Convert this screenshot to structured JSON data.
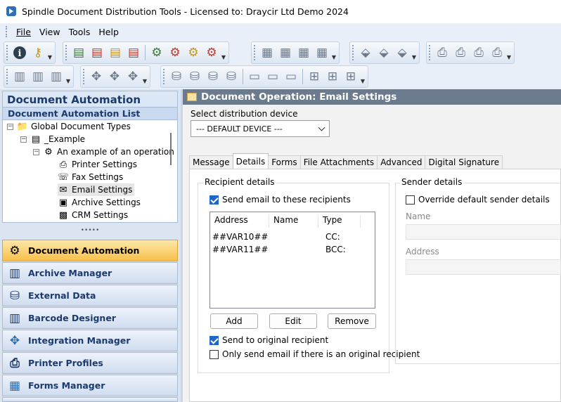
{
  "window": {
    "title": "Spindle Document Distribution Tools - Licensed to: Draycir Ltd Demo 2024"
  },
  "menu": {
    "file": "File",
    "view": "View",
    "tools": "Tools",
    "help": "Help"
  },
  "left_panel": {
    "header": "Document Automation",
    "subheader": "Document Automation List",
    "tree": {
      "root": "Global Document Types",
      "example": "_Example",
      "operation": "An example of an operation",
      "printer": "Printer Settings",
      "fax": "Fax Settings",
      "email": "Email Settings",
      "archive": "Archive Settings",
      "crm": "CRM Settings"
    },
    "splitter": "•••••",
    "nav": {
      "document_automation": "Document Automation",
      "archive_manager": "Archive Manager",
      "external_data": "External Data",
      "barcode_designer": "Barcode Designer",
      "integration_manager": "Integration Manager",
      "printer_profiles": "Printer Profiles",
      "forms_manager": "Forms Manager"
    }
  },
  "right_panel": {
    "header": "Document Operation: Email Settings",
    "device_label": "Select distribution device",
    "device_value": "--- DEFAULT DEVICE ---",
    "tabs": {
      "message": "Message",
      "details": "Details",
      "forms": "Forms",
      "file_attachments": "File Attachments",
      "advanced": "Advanced",
      "digital_signature": "Digital Signature"
    },
    "recipient": {
      "group_label": "Recipient details",
      "send_email": "Send email to these recipients",
      "col_address": "Address",
      "col_name": "Name",
      "col_type": "Type",
      "rows": [
        {
          "address": "##VAR10##",
          "name": "",
          "type": "CC:"
        },
        {
          "address": "##VAR11##",
          "name": "",
          "type": "BCC:"
        }
      ],
      "add": "Add",
      "edit": "Edit",
      "remove": "Remove",
      "send_original": "Send to original recipient",
      "only_original": "Only send email if there is an original recipient"
    },
    "sender": {
      "group_label": "Sender details",
      "override": "Override default sender details",
      "name_label": "Name",
      "address_label": "Address"
    }
  }
}
